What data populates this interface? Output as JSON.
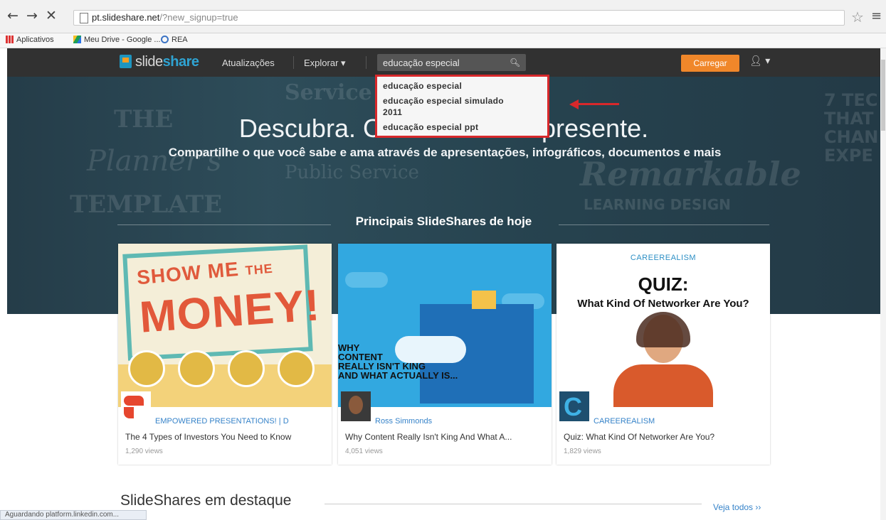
{
  "browser": {
    "url_host": "pt.slideshare.net",
    "url_path": "/?new_signup=true",
    "bookmarks": [
      "Aplicativos",
      "Meu Drive - Google ...",
      "REA"
    ],
    "status_text": "Aguardando platform.linkedin.com..."
  },
  "nav": {
    "logo_light": "slide",
    "logo_bold": "share",
    "updates": "Atualizações",
    "explore": "Explorar ▾",
    "search_value": "educação especial",
    "upload": "Carregar"
  },
  "suggestions": [
    "educação especial",
    "educação especial simulado",
    "2011",
    "educação especial ppt"
  ],
  "hero": {
    "title": "Descubra. Co",
    "title_tail": "presente.",
    "subtitle": "Compartilhe o que você sabe e ama através de apresentações, infográficos, documentos e mais",
    "section_title": "Principais SlideShares de hoje"
  },
  "cards": [
    {
      "author": "EMPOWERED PRESENTATIONS! | D",
      "title": "The 4 Types of Investors You Need to Know",
      "views": "1,290 views",
      "thumb_text": [
        "SHOW ME",
        "THE",
        "MONEY!"
      ]
    },
    {
      "author": "Ross Simmonds",
      "title": "Why Content Really Isn't King And What A...",
      "views": "4,051 views",
      "thumb_text": [
        "WHY",
        "CONTENT",
        "REALLY ISN'T KING",
        "AND WHAT ACTUALLY IS..."
      ]
    },
    {
      "author": "CAREEREALISM",
      "title": "Quiz: What Kind Of Networker Are You?",
      "views": "1,829 views",
      "thumb_text": [
        "CAREEREALISM",
        "QUIZ:",
        "What Kind Of Networker Are You?"
      ]
    }
  ],
  "featured": {
    "title": "SlideShares em destaque",
    "see_all": "Veja todos ››"
  },
  "colors": {
    "accent": "#f0872a",
    "link": "#3683c9",
    "highlight": "#d8282b",
    "nav_bg": "#313131"
  }
}
